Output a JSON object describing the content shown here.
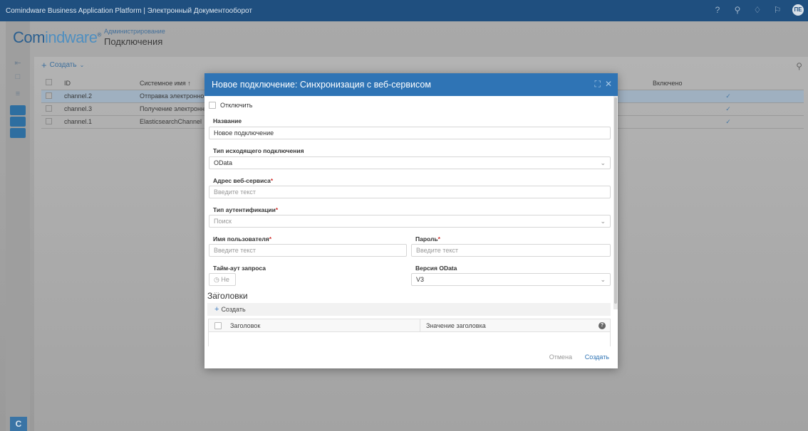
{
  "topbar": {
    "title": "Comindware Business Application Platform  |  Электронный Документооборот",
    "user_initials": "ПЕ"
  },
  "logo": {
    "part1": "Com",
    "part2": "indware",
    "mark": "®"
  },
  "breadcrumb": {
    "parent": "Администрирование",
    "current": "Подключения"
  },
  "list": {
    "create_label": "Создать",
    "columns": [
      "ID",
      "Системное имя ↑",
      "Включено"
    ],
    "rows": [
      {
        "id": "channel.2",
        "name": "Отправка электронно",
        "enabled": "✓"
      },
      {
        "id": "channel.3",
        "name": "Получение электронно",
        "enabled": "✓"
      },
      {
        "id": "channel.1",
        "name": "ElasticsearchChannel",
        "enabled": "✓"
      }
    ]
  },
  "modal": {
    "title": "Новое подключение: Синхронизация с веб-сервисом",
    "disable_label": "Отключить",
    "name_label": "Название",
    "name_value": "Новое подключение",
    "out_type_label": "Тип исходящего подключения",
    "out_type_value": "OData",
    "address_label": "Адрес веб-сервиса",
    "address_placeholder": "Введите текст",
    "auth_label": "Тип аутентификации",
    "auth_placeholder": "Поиск",
    "user_label": "Имя пользователя",
    "user_placeholder": "Введите текст",
    "password_label": "Пароль",
    "password_placeholder": "Введите текст",
    "timeout_label": "Тайм-аут запроса",
    "timeout_placeholder": "Не ...",
    "odata_version_label": "Версия OData",
    "odata_version_value": "V3",
    "headers_title": "Заголовки",
    "headers_create": "Создать",
    "headers_col1": "Заголовок",
    "headers_col2": "Значение заголовка",
    "cancel_label": "Отмена",
    "create_label": "Создать"
  },
  "colors": {
    "accent": "#2f74b5",
    "topbar": "#1f4f7f",
    "required": "#d0312d"
  }
}
